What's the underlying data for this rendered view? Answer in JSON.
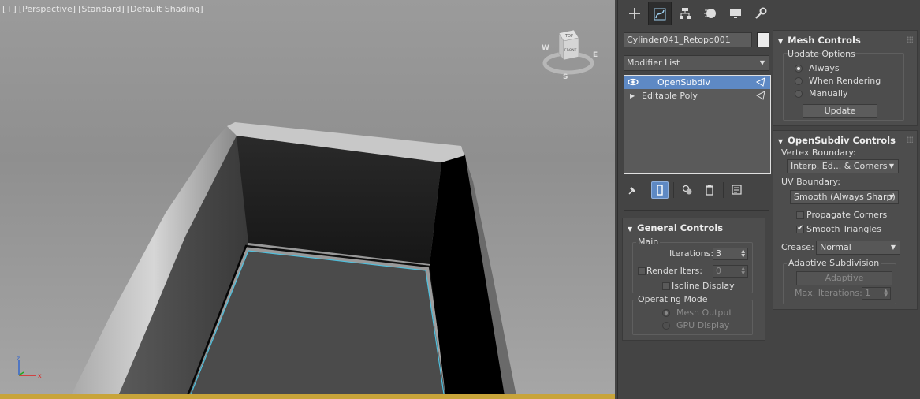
{
  "viewport": {
    "labels": [
      "[+]",
      "[Perspective]",
      "[Standard]",
      "[Default Shading]"
    ],
    "viewcube": {
      "top": "TOP",
      "front": "FRONT",
      "compass_w": "W",
      "compass_e": "E",
      "compass_s": "S"
    },
    "gizmo": {
      "x": "x",
      "z": "z"
    },
    "wire_color": "#4ec0de"
  },
  "command_panel": {
    "tabs": [
      {
        "name": "create",
        "icon": "plus-icon"
      },
      {
        "name": "modify",
        "icon": "modify-curve-icon",
        "active": true
      },
      {
        "name": "hierarchy",
        "icon": "hierarchy-icon"
      },
      {
        "name": "motion",
        "icon": "motion-icon"
      },
      {
        "name": "display",
        "icon": "display-monitor-icon"
      },
      {
        "name": "utilities",
        "icon": "wrench-icon"
      }
    ],
    "object_name": "Cylinder041_Retopo001",
    "object_color": "#ececec",
    "modifier_list": "Modifier List",
    "stack": [
      {
        "label": "OpenSubdiv",
        "selected": true
      },
      {
        "label": "Editable Poly",
        "selected": false
      }
    ]
  },
  "general_controls": {
    "title": "General Controls",
    "main": {
      "label": "Main",
      "iterations_label": "Iterations:",
      "iterations_value": "3",
      "render_iters_label": "Render Iters:",
      "render_iters_value": "0",
      "isoline_label": "Isoline Display"
    },
    "operating_mode": {
      "label": "Operating Mode",
      "mesh_output": "Mesh Output",
      "gpu_display": "GPU Display"
    }
  },
  "mesh_controls": {
    "title": "Mesh Controls",
    "update_options": {
      "label": "Update Options",
      "always": "Always",
      "when_rendering": "When Rendering",
      "manually": "Manually",
      "update_button": "Update"
    }
  },
  "opensubdiv_controls": {
    "title": "OpenSubdiv Controls",
    "vertex_boundary_label": "Vertex Boundary:",
    "vertex_boundary_value": "Interp. Ed... & Corners",
    "uv_boundary_label": "UV Boundary:",
    "uv_boundary_value": "Smooth (Always Sharp)",
    "propagate_corners": "Propagate Corners",
    "smooth_triangles": "Smooth Triangles",
    "crease_label": "Crease:",
    "crease_value": "Normal",
    "adaptive": {
      "label": "Adaptive Subdivision",
      "button": "Adaptive",
      "max_iter_label": "Max. Iterations:",
      "max_iter_value": "1"
    }
  }
}
